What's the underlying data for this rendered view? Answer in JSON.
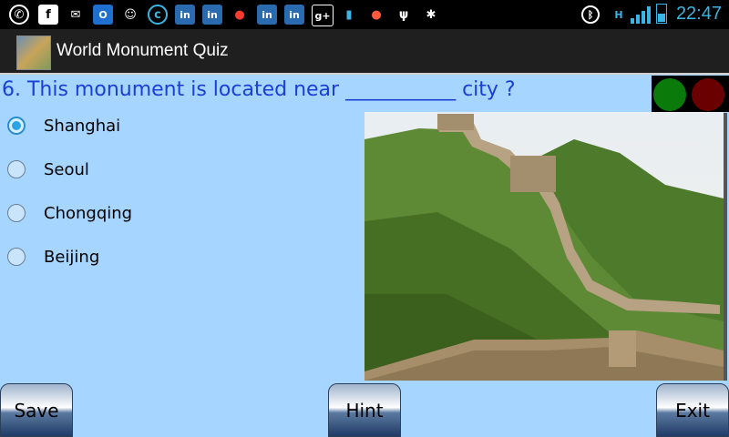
{
  "status_bar": {
    "left_icons": [
      "whatsapp-icon",
      "facebook-icon",
      "mail-icon",
      "outlook-icon",
      "messaging-icon",
      "app-c-icon",
      "linkedin-icon",
      "linkedin-icon",
      "notification-icon",
      "linkedin-icon",
      "linkedin-icon",
      "google-plus-icon",
      "battery-saver-icon",
      "maps-pin-icon",
      "usb-icon",
      "android-debug-icon"
    ],
    "right_icons": [
      "bluetooth-icon",
      "hspa-data-icon",
      "signal-icon",
      "battery-icon"
    ],
    "time": "22:47"
  },
  "action_bar": {
    "title": "World Monument Quiz"
  },
  "quiz": {
    "question": "6. This monument is located near ___________ city ?",
    "options": [
      {
        "label": "Shanghai",
        "selected": true
      },
      {
        "label": "Seoul",
        "selected": false
      },
      {
        "label": "Chongqing",
        "selected": false
      },
      {
        "label": "Beijing",
        "selected": false
      }
    ],
    "indicator_colors": {
      "correct": "#0a7a0a",
      "wrong": "#6a0000"
    }
  },
  "buttons": {
    "save": "Save",
    "hint": "Hint",
    "exit": "Exit"
  },
  "colors": {
    "background": "#a6d6ff",
    "question_text": "#1a3fd6",
    "clock": "#3ab5e6"
  }
}
